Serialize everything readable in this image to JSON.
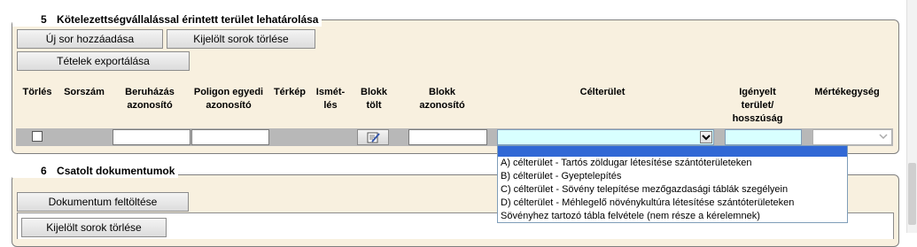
{
  "section5": {
    "number": "5",
    "title": "Kötelezettségvállalással érintett terület lehatárolása",
    "buttons": {
      "add_row": "Új sor hozzáadása",
      "delete_selected": "Kijelölt sorok törlése",
      "export_items": "Tételek exportálása"
    },
    "columns": {
      "delete": "Törlés",
      "serial": "Sorszám",
      "investment_id": "Beruházás azonosító",
      "polygon_id": "Poligon egyedi azonosító",
      "map": "Térkép",
      "repetition": "Ismét-lés",
      "block_load": "Blokk tölt",
      "block_id": "Blokk azonosító",
      "target_area": "Célterület",
      "requested_area": "Igényelt terület/ hosszúság",
      "unit": "Mértékegység"
    },
    "row": {
      "investment_id": "",
      "polygon_id": "",
      "block_id": "",
      "target_area": "",
      "requested_area": "",
      "unit": ""
    },
    "target_area_options": [
      "",
      "A) célterület - Tartós zöldugar létesítése szántóterületeken",
      "B) célterület - Gyeptelepítés",
      "C) célterület - Sövény telepítése mezőgazdasági táblák szegélyein",
      "D) célterület - Méhlegelő növénykultúra létesítése szántóterületeken",
      "Sövényhez tartozó tábla felvétele (nem része a kérelemnek)"
    ]
  },
  "section6": {
    "number": "6",
    "title": "Csatolt dokumentumok",
    "buttons": {
      "upload_document": "Dokumentum feltöltése",
      "delete_selected": "Kijelölt sorok törlése"
    }
  },
  "colors": {
    "panel_bg": "#f8f0df",
    "row_bg": "#b8b8b8",
    "highlight_input": "#d8ffff",
    "dropdown_selected": "#3168d5"
  }
}
